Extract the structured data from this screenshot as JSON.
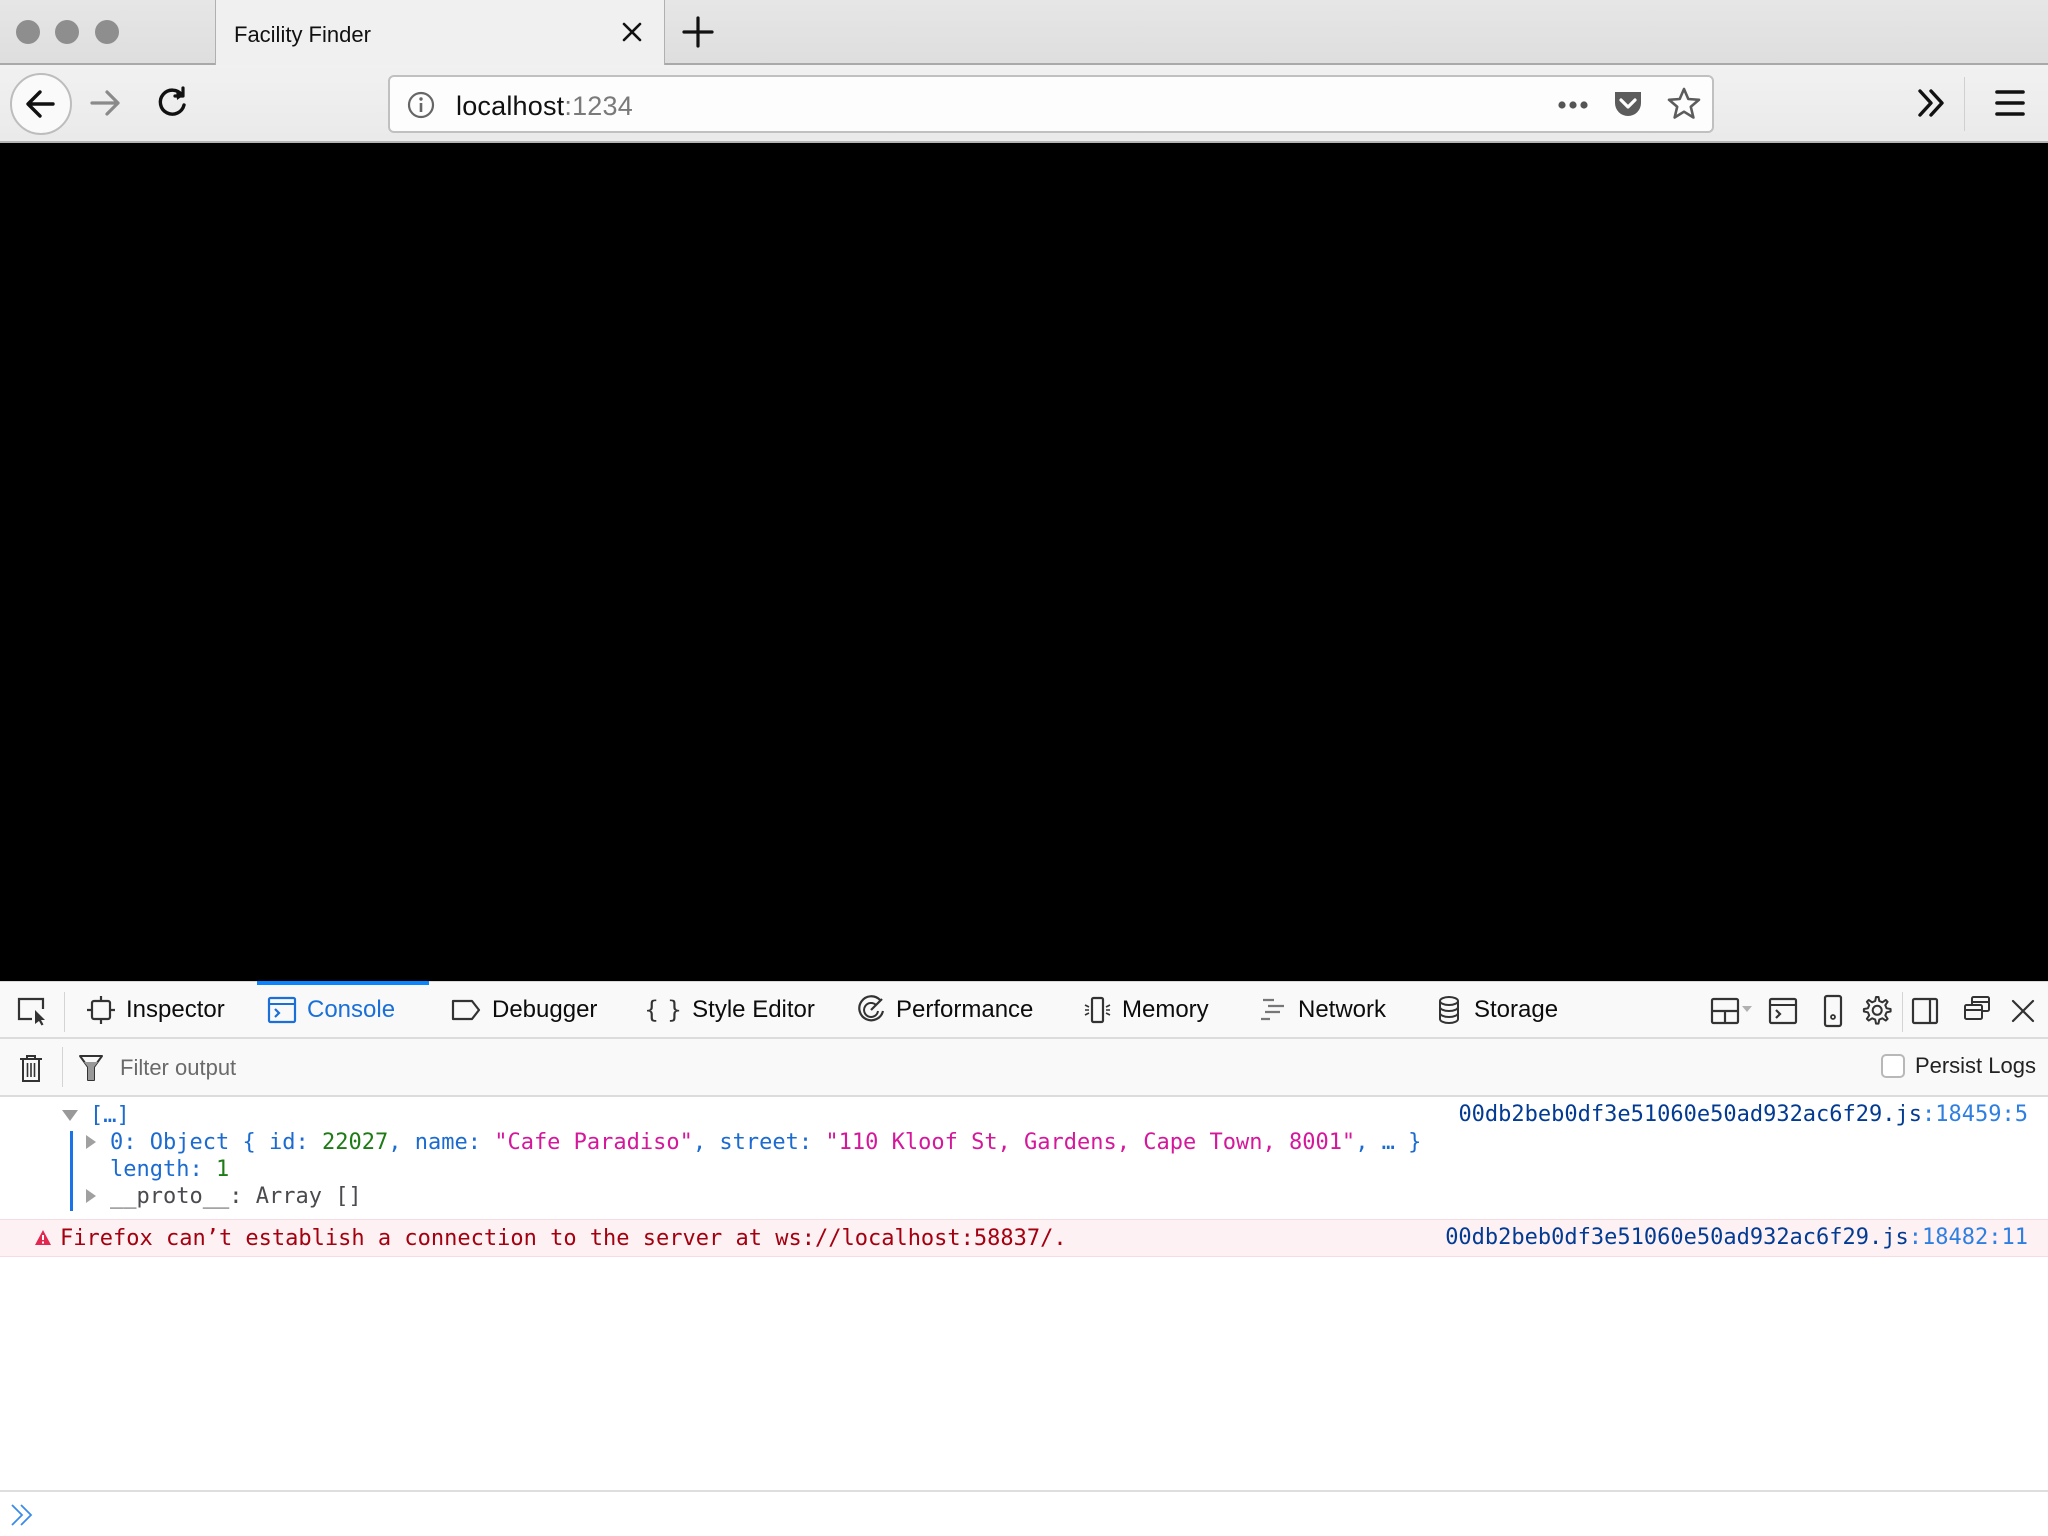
{
  "browser": {
    "tab": {
      "title": "Facility Finder"
    },
    "url": {
      "host": "localhost",
      "port": ":1234"
    }
  },
  "devtools": {
    "tabs": [
      {
        "id": "inspector",
        "label": "Inspector",
        "icon": "inspector-icon",
        "selected": false
      },
      {
        "id": "console",
        "label": "Console",
        "icon": "console-icon",
        "selected": true
      },
      {
        "id": "debugger",
        "label": "Debugger",
        "icon": "debugger-icon",
        "selected": false
      },
      {
        "id": "style-editor",
        "label": "Style Editor",
        "icon": "braces-icon",
        "selected": false
      },
      {
        "id": "performance",
        "label": "Performance",
        "icon": "performance-icon",
        "selected": false
      },
      {
        "id": "memory",
        "label": "Memory",
        "icon": "memory-icon",
        "selected": false
      },
      {
        "id": "network",
        "label": "Network",
        "icon": "network-icon",
        "selected": false
      },
      {
        "id": "storage",
        "label": "Storage",
        "icon": "storage-icon",
        "selected": false
      }
    ],
    "filter": {
      "placeholder": "Filter output",
      "value": ""
    },
    "persist_logs": {
      "label": "Persist Logs",
      "checked": false
    },
    "console": {
      "log": {
        "summary": "[…]",
        "entry0": {
          "index": "0",
          "type": "Object",
          "id_key": "id",
          "id_value": "22027",
          "name_key": "name",
          "name_value": "\"Cafe Paradiso\"",
          "street_key": "street",
          "street_value": "\"110 Kloof St, Gardens, Cape Town, 8001\""
        },
        "length_key": "length",
        "length_value": "1",
        "proto_key": "__proto__",
        "proto_value": "Array []",
        "source_file": "00db2beb0df3e51060e50ad932ac6f29.js",
        "source_line": ":18459:5"
      },
      "error": {
        "message": "Firefox can’t establish a connection to the server at ws://localhost:58837/.",
        "source_file": "00db2beb0df3e51060e50ad932ac6f29.js",
        "source_line": ":18482:11"
      },
      "input_value": ""
    }
  },
  "colors": {
    "accent": "#0a84ff",
    "error_text": "#a4000f",
    "error_bg": "#fdf1f4",
    "string": "#d5189b",
    "number": "#1e7b16",
    "key": "#1c6bd0"
  }
}
